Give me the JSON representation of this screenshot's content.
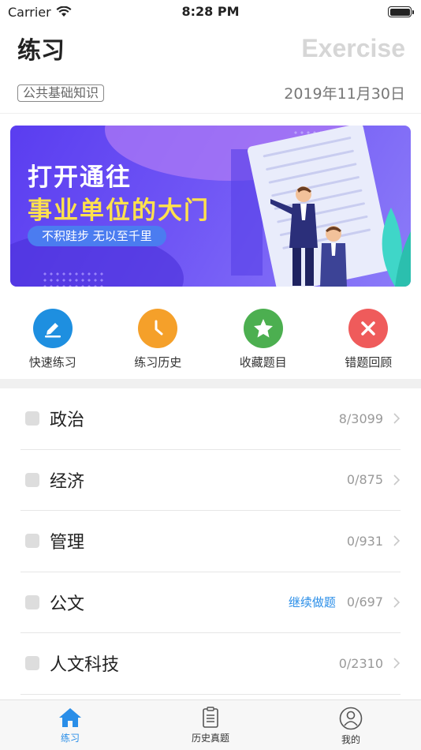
{
  "status_bar": {
    "carrier": "Carrier",
    "time": "8:28 PM",
    "battery": 1.0
  },
  "header": {
    "title": "练习",
    "title_en": "Exercise"
  },
  "subheader": {
    "category": "公共基础知识",
    "date": "2019年11月30日"
  },
  "banner": {
    "line1": "打开通往",
    "line2": "事业单位的大门",
    "tagline": "不积跬步 无以至千里"
  },
  "quick_actions": [
    {
      "label": "快速练习",
      "icon": "pencil-icon",
      "color": "#1e8fe0"
    },
    {
      "label": "练习历史",
      "icon": "clock-icon",
      "color": "#f5a02a"
    },
    {
      "label": "收藏题目",
      "icon": "star-icon",
      "color": "#4caf50"
    },
    {
      "label": "错题回顾",
      "icon": "close-icon",
      "color": "#ef5b5b"
    }
  ],
  "subjects": [
    {
      "label": "政治",
      "count": "8/3099",
      "continue": ""
    },
    {
      "label": "经济",
      "count": "0/875",
      "continue": ""
    },
    {
      "label": "管理",
      "count": "0/931",
      "continue": ""
    },
    {
      "label": "公文",
      "count": "0/697",
      "continue": "继续做题"
    },
    {
      "label": "人文科技",
      "count": "0/2310",
      "continue": ""
    }
  ],
  "tabs": [
    {
      "label": "练习",
      "icon": "home-icon",
      "active": true
    },
    {
      "label": "历史真题",
      "icon": "clipboard-icon",
      "active": false
    },
    {
      "label": "我的",
      "icon": "user-icon",
      "active": false
    }
  ],
  "colors": {
    "accent": "#2a8ee8"
  }
}
